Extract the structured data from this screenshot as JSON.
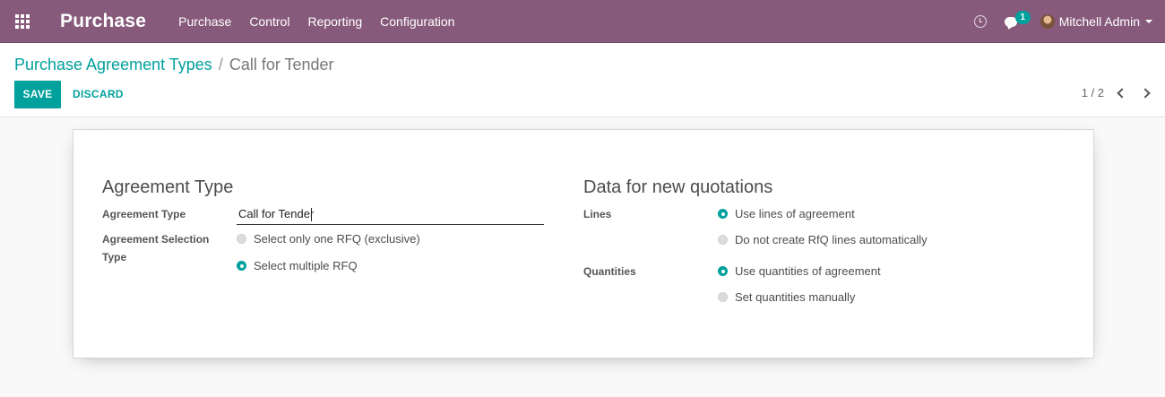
{
  "navbar": {
    "app_name": "Purchase",
    "menu": [
      "Purchase",
      "Control",
      "Reporting",
      "Configuration"
    ],
    "chat_count": "1",
    "user_name": "Mitchell Admin",
    "color": "#875a7b"
  },
  "breadcrumb": {
    "parent": "Purchase Agreement Types",
    "separator": "/",
    "current": "Call for Tender"
  },
  "buttons": {
    "save": "SAVE",
    "discard": "DISCARD"
  },
  "pager": {
    "value": "1 / 2"
  },
  "form": {
    "left_title": "Agreement Type",
    "agreement_type_label": "Agreement Type",
    "agreement_type_value": "Call for Tender",
    "selection_type_label_line1": "Agreement Selection",
    "selection_type_label_line2": "Type",
    "selection_options": [
      {
        "label": "Select only one RFQ (exclusive)",
        "selected": false
      },
      {
        "label": "Select multiple RFQ",
        "selected": true
      }
    ],
    "right_title": "Data for new quotations",
    "lines_label": "Lines",
    "lines_options": [
      {
        "label": "Use lines of agreement",
        "selected": true
      },
      {
        "label": "Do not create RfQ lines automatically",
        "selected": false
      }
    ],
    "quantities_label": "Quantities",
    "quantities_options": [
      {
        "label": "Use quantities of agreement",
        "selected": true
      },
      {
        "label": "Set quantities manually",
        "selected": false
      }
    ]
  },
  "accent_color": "#00a09d"
}
